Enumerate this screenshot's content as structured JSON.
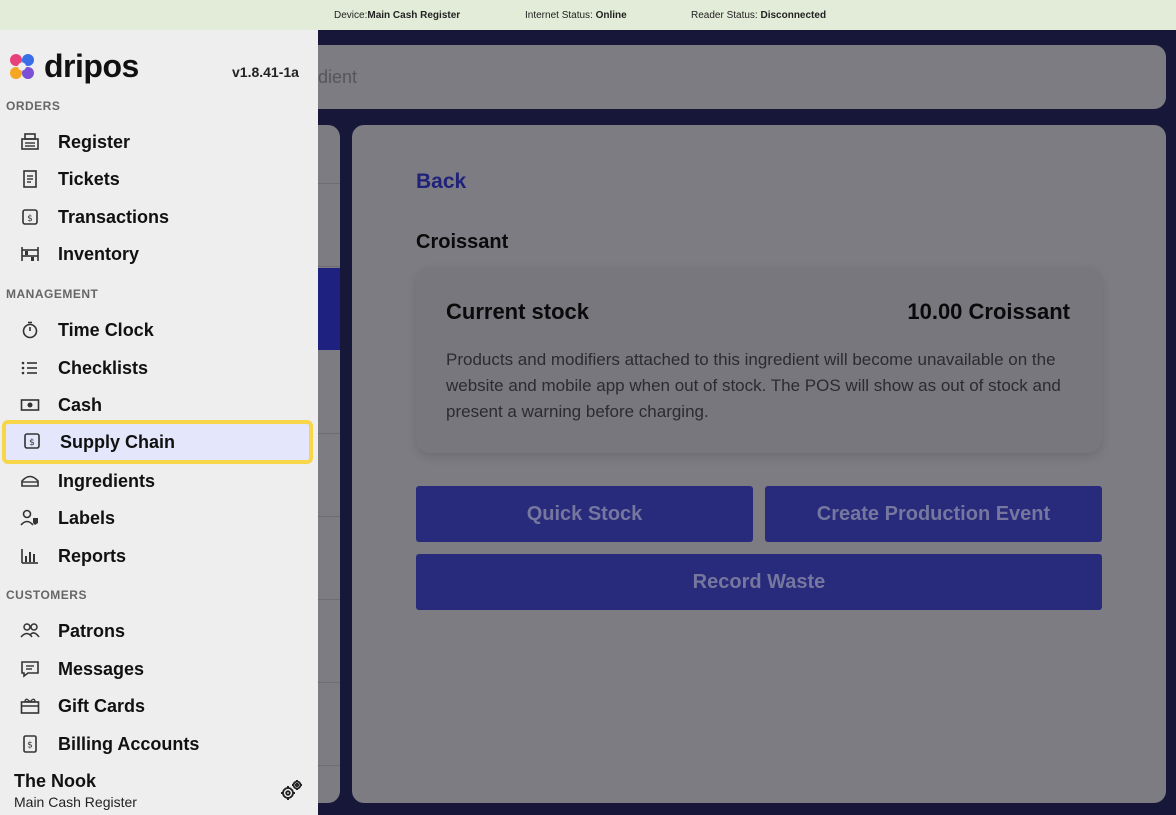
{
  "status_bar": {
    "device_label": "Device:",
    "device_value": "Main Cash Register",
    "internet_label": "Internet Status: ",
    "internet_value": "Online",
    "reader_label": "Reader Status: ",
    "reader_value": "Disconnected"
  },
  "app": {
    "search_placeholder_fragment": "dient",
    "back_label": "Back",
    "ingredient_title": "Croissant",
    "stock_card": {
      "label": "Current stock",
      "value": "10.00 Croissant",
      "description": "Products and modifiers attached to this ingredient will become unavailable on the website and mobile app when out of stock. The POS will show as out of stock and present a warning before charging."
    },
    "buttons": {
      "quick_stock": "Quick Stock",
      "create_production_event": "Create Production Event",
      "record_waste": "Record Waste"
    }
  },
  "sidebar": {
    "brand": "dripos",
    "version": "v1.8.41-1a",
    "sections": {
      "orders": "ORDERS",
      "management": "MANAGEMENT",
      "customers": "CUSTOMERS"
    },
    "items": [
      {
        "label": "Register",
        "icon": "register-icon"
      },
      {
        "label": "Tickets",
        "icon": "ticket-icon"
      },
      {
        "label": "Transactions",
        "icon": "receipt-dollar-icon"
      },
      {
        "label": "Inventory",
        "icon": "shelves-icon"
      },
      {
        "label": "Time Clock",
        "icon": "stopwatch-icon"
      },
      {
        "label": "Checklists",
        "icon": "checklist-icon"
      },
      {
        "label": "Cash",
        "icon": "cash-icon"
      },
      {
        "label": "Supply Chain",
        "icon": "box-dollar-icon",
        "active": true
      },
      {
        "label": "Ingredients",
        "icon": "ingredients-icon"
      },
      {
        "label": "Labels",
        "icon": "label-user-icon"
      },
      {
        "label": "Reports",
        "icon": "bar-chart-icon"
      },
      {
        "label": "Patrons",
        "icon": "users-icon"
      },
      {
        "label": "Messages",
        "icon": "message-icon"
      },
      {
        "label": "Gift Cards",
        "icon": "gift-card-icon"
      },
      {
        "label": "Billing Accounts",
        "icon": "billing-icon"
      }
    ],
    "footer": {
      "location": "The Nook",
      "device": "Main Cash Register"
    }
  },
  "colors": {
    "accent": "#2b2d8f",
    "highlight_border": "#f7d64a",
    "status_bar_bg": "#e3ecd9"
  }
}
